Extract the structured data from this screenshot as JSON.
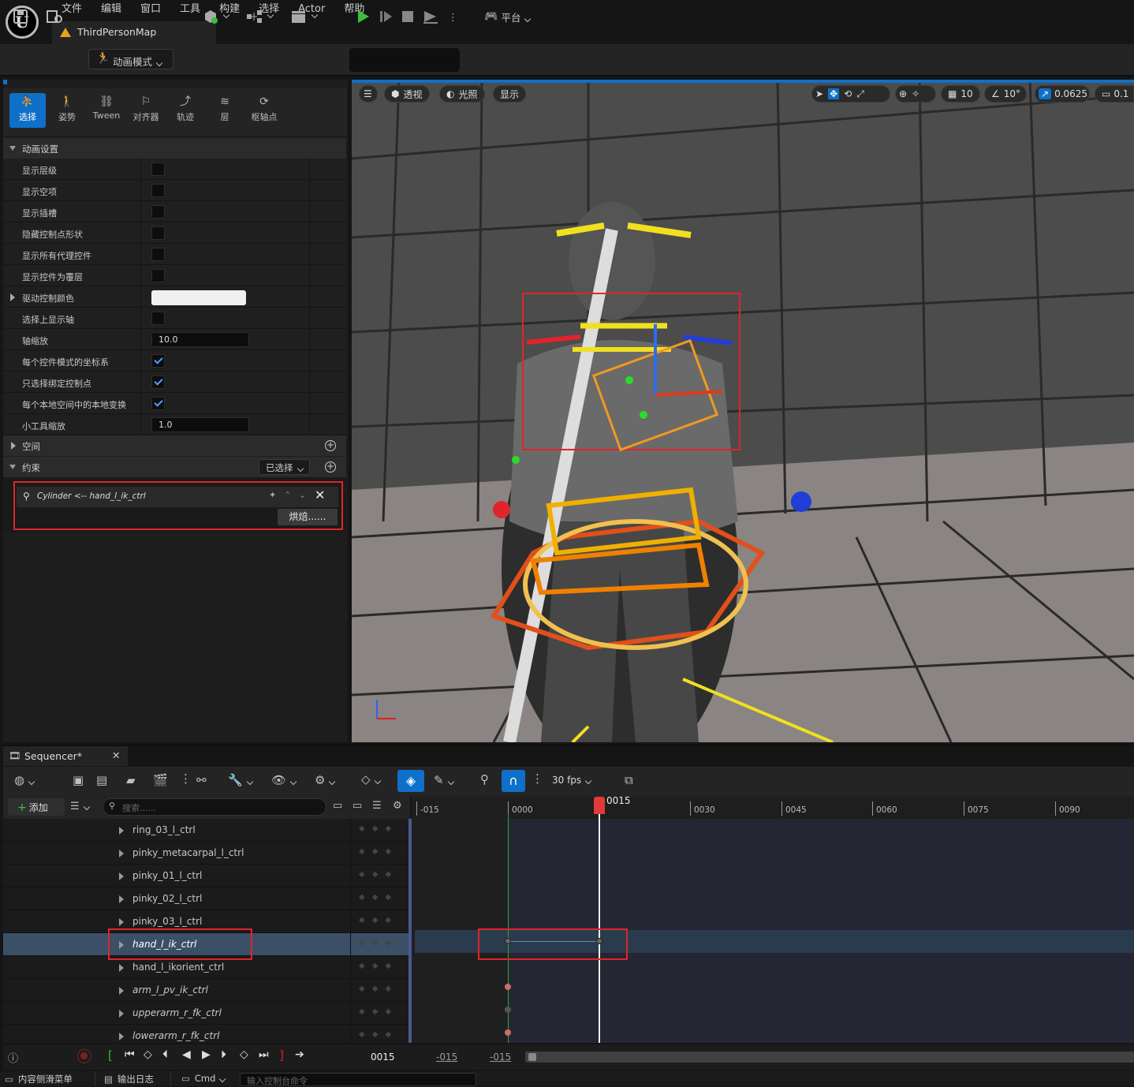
{
  "menu": [
    "文件",
    "编辑",
    "窗口",
    "工具",
    "构建",
    "选择",
    "Actor",
    "帮助"
  ],
  "map_tab": "ThirdPersonMap",
  "toolbar": {
    "mode_label": "动画模式",
    "platform_label": "平台"
  },
  "mode_tabs": [
    "选择",
    "姿势",
    "Tween",
    "对齐器",
    "轨迹",
    "层",
    "枢轴点"
  ],
  "anim_settings": {
    "header": "动画设置",
    "rows": [
      {
        "label": "显示层级",
        "type": "checkbox",
        "checked": false
      },
      {
        "label": "显示空项",
        "type": "checkbox",
        "checked": false
      },
      {
        "label": "显示插槽",
        "type": "checkbox",
        "checked": false
      },
      {
        "label": "隐藏控制点形状",
        "type": "checkbox",
        "checked": false
      },
      {
        "label": "显示所有代理控件",
        "type": "checkbox",
        "checked": false
      },
      {
        "label": "显示控件为覆层",
        "type": "checkbox",
        "checked": false
      },
      {
        "label": "驱动控制颜色",
        "type": "color",
        "expandable": true
      },
      {
        "label": "选择上显示轴",
        "type": "checkbox",
        "checked": false
      },
      {
        "label": "轴缩放",
        "type": "number",
        "value": "10.0"
      },
      {
        "label": "每个控件模式的坐标系",
        "type": "checkbox",
        "checked": true
      },
      {
        "label": "只选择绑定控制点",
        "type": "checkbox",
        "checked": true
      },
      {
        "label": "每个本地空间中的本地变换",
        "type": "checkbox",
        "checked": true
      },
      {
        "label": "小工具缩放",
        "type": "number",
        "value": "1.0"
      }
    ]
  },
  "space_section": "空间",
  "constraint_section": {
    "label": "约束",
    "dropdown": "已选择",
    "item": "Cylinder <-- hand_l_ik_ctrl",
    "bake": "烘焙......"
  },
  "viewport": {
    "perspective": "透视",
    "lighting": "光照",
    "show": "显示",
    "grid": "10",
    "angle": "10°",
    "scale": "0.0625",
    "camera": "0.1"
  },
  "sequencer": {
    "title": "Sequencer*",
    "fps": "30 fps",
    "add": "添加",
    "search_placeholder": "搜索......",
    "current_frame": "0015",
    "start": "-015",
    "end": "-015",
    "ruler": [
      "-015",
      "0000",
      "0030",
      "0045",
      "0060",
      "0075",
      "0090"
    ],
    "tracks": [
      {
        "name": "ring_03_l_ctrl",
        "italic": false
      },
      {
        "name": "pinky_metacarpal_l_ctrl",
        "italic": false
      },
      {
        "name": "pinky_01_l_ctrl",
        "italic": false
      },
      {
        "name": "pinky_02_l_ctrl",
        "italic": false
      },
      {
        "name": "pinky_03_l_ctrl",
        "italic": false
      },
      {
        "name": "hand_l_ik_ctrl",
        "italic": true
      },
      {
        "name": "hand_l_ikorient_ctrl",
        "italic": false
      },
      {
        "name": "arm_l_pv_ik_ctrl",
        "italic": true
      },
      {
        "name": "upperarm_r_fk_ctrl",
        "italic": true
      },
      {
        "name": "lowerarm_r_fk_ctrl",
        "italic": true
      }
    ]
  },
  "statusbar": {
    "drawer": "内容侧滑菜单",
    "output": "输出日志",
    "cmd": "Cmd",
    "console_placeholder": "输入控制台命令"
  },
  "colors": {
    "accent": "#0e70c8",
    "highlight": "#e0242c",
    "play": "#3cbf3c"
  }
}
